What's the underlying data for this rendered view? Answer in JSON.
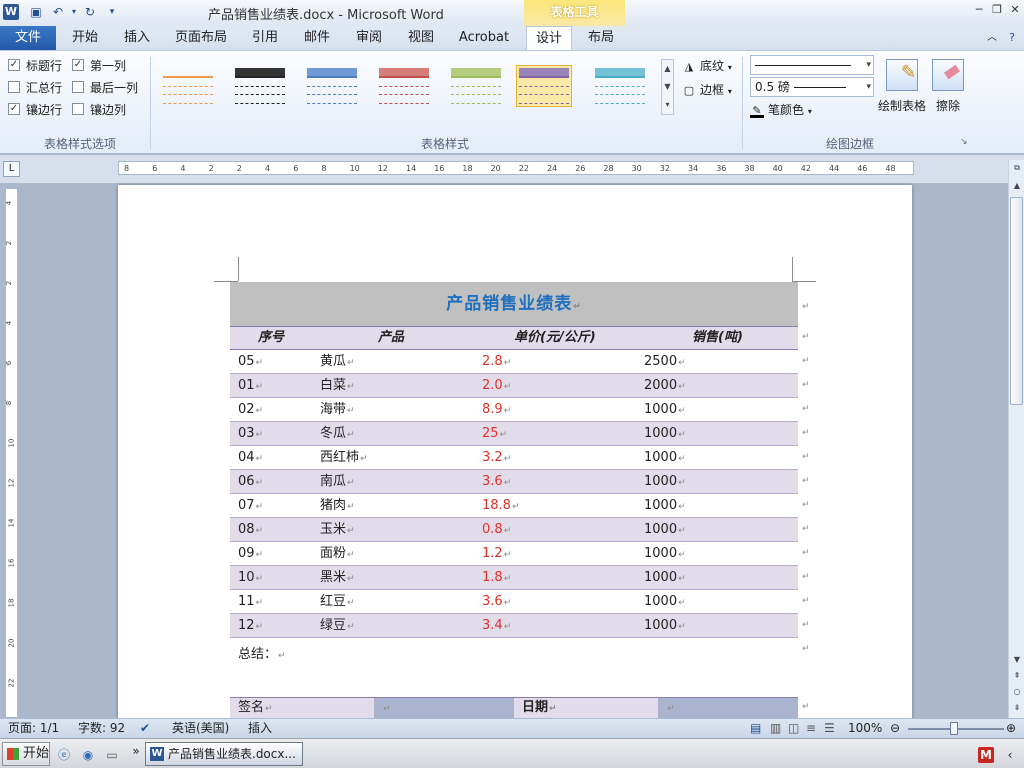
{
  "window": {
    "title": "产品销售业绩表.docx - Microsoft Word",
    "contextual_tab": "表格工具"
  },
  "tabs": [
    "文件",
    "开始",
    "插入",
    "页面布局",
    "引用",
    "邮件",
    "审阅",
    "视图",
    "Acrobat",
    "设计",
    "布局"
  ],
  "active_tab": "设计",
  "ribbon": {
    "style_options": {
      "header_row": "标题行",
      "first_column": "第一列",
      "total_row": "汇总行",
      "last_column": "最后一列",
      "banded_rows": "镶边行",
      "banded_columns": "镶边列",
      "group_label": "表格样式选项"
    },
    "styles_group_label": "表格样式",
    "shading_label": "底纹",
    "borders_label": "边框",
    "pen_weight": "0.5 磅",
    "pen_color_label": "笔颜色",
    "draw_table_label": "绘制表格",
    "eraser_label": "擦除",
    "draw_borders_group_label": "绘图边框"
  },
  "ruler": {
    "labels": [
      "8",
      "6",
      "4",
      "2",
      "2",
      "4",
      "6",
      "8",
      "10",
      "12",
      "14",
      "16",
      "18",
      "20",
      "22",
      "24",
      "26",
      "28",
      "30",
      "32",
      "34",
      "36",
      "38",
      "40",
      "42",
      "44",
      "46",
      "48"
    ]
  },
  "document": {
    "table_title": "产品销售业绩表",
    "headers": {
      "id": "序号",
      "product": "产品",
      "price": "单价(元/公斤)",
      "sales": "销售(吨)"
    },
    "rows": [
      {
        "id": "05",
        "product": "黄瓜",
        "price": "2.8",
        "sales": "2500"
      },
      {
        "id": "01",
        "product": "白菜",
        "price": "2.0",
        "sales": "2000"
      },
      {
        "id": "02",
        "product": "海带",
        "price": "8.9",
        "sales": "1000"
      },
      {
        "id": "03",
        "product": "冬瓜",
        "price": "25",
        "sales": "1000"
      },
      {
        "id": "04",
        "product": "西红柿",
        "price": "3.2",
        "sales": "1000"
      },
      {
        "id": "06",
        "product": "南瓜",
        "price": "3.6",
        "sales": "1000"
      },
      {
        "id": "07",
        "product": "猪肉",
        "price": "18.8",
        "sales": "1000"
      },
      {
        "id": "08",
        "product": "玉米",
        "price": "0.8",
        "sales": "1000"
      },
      {
        "id": "09",
        "product": "面粉",
        "price": "1.2",
        "sales": "1000"
      },
      {
        "id": "10",
        "product": "黑米",
        "price": "1.8",
        "sales": "1000"
      },
      {
        "id": "11",
        "product": "红豆",
        "price": "3.6",
        "sales": "1000"
      },
      {
        "id": "12",
        "product": "绿豆",
        "price": "3.4",
        "sales": "1000"
      }
    ],
    "summary_label": "总结：",
    "sign_label": "签名",
    "date_label": "日期"
  },
  "status": {
    "page": "页面: 1/1",
    "words": "字数: 92",
    "language": "英语(美国)",
    "mode": "插入",
    "zoom": "100%"
  },
  "taskbar": {
    "start": "开始",
    "word_task": "产品销售业绩表.docx..."
  },
  "colors": {
    "accent_blue": "#2458a8",
    "title_text": "#1f6fbf",
    "price_red": "#e0302a",
    "band_purple": "#e2dcea"
  }
}
